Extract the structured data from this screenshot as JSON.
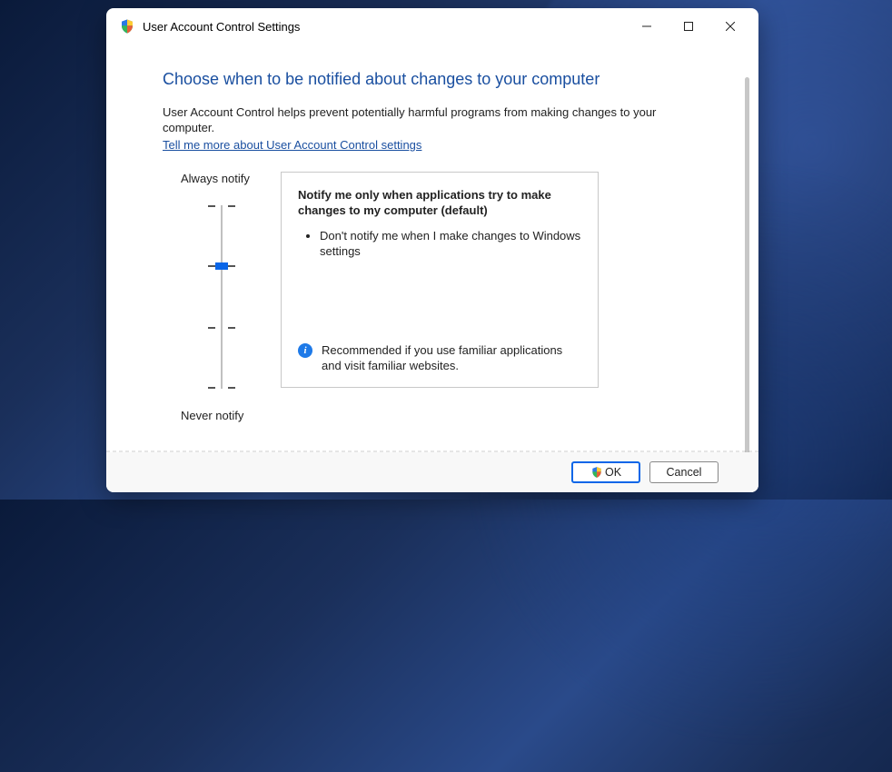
{
  "window": {
    "title": "User Account Control Settings"
  },
  "page": {
    "heading": "Choose when to be notified about changes to your computer",
    "description": "User Account Control helps prevent potentially harmful programs from making changes to your computer.",
    "link": "Tell me more about User Account Control settings"
  },
  "slider": {
    "top_label": "Always notify",
    "bottom_label": "Never notify",
    "levels": 4,
    "current_level": 2
  },
  "current_setting": {
    "title": "Notify me only when applications try to make changes to my computer (default)",
    "bullet": "Don't notify me when I make changes to Windows settings",
    "recommendation": "Recommended if you use familiar applications and visit familiar websites."
  },
  "buttons": {
    "ok": "OK",
    "cancel": "Cancel"
  }
}
